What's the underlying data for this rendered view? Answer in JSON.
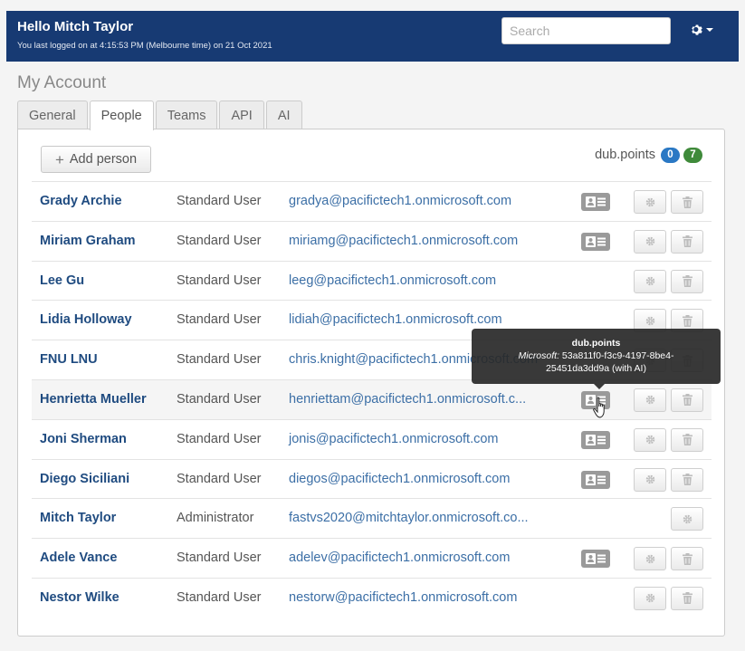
{
  "header": {
    "greeting": "Hello Mitch Taylor",
    "last_login": "You last logged on at 4:15:53 PM (Melbourne time) on 21 Oct 2021",
    "search_placeholder": "Search",
    "settings_icon": "gear-icon"
  },
  "page": {
    "title": "My Account"
  },
  "tabs": [
    {
      "label": "General",
      "active": false
    },
    {
      "label": "People",
      "active": true
    },
    {
      "label": "Teams",
      "active": false
    },
    {
      "label": "API",
      "active": false
    },
    {
      "label": "AI",
      "active": false
    }
  ],
  "toolbar": {
    "add_person_label": "Add person",
    "points_label": "dub.points",
    "points_blue": "0",
    "points_green": "7"
  },
  "people": [
    {
      "name": "Grady Archie",
      "role": "Standard User",
      "email": "gradya@pacifictech1.onmicrosoft.com",
      "card": true,
      "trash": true
    },
    {
      "name": "Miriam Graham",
      "role": "Standard User",
      "email": "miriamg@pacifictech1.onmicrosoft.com",
      "card": true,
      "trash": true
    },
    {
      "name": "Lee Gu",
      "role": "Standard User",
      "email": "leeg@pacifictech1.onmicrosoft.com",
      "card": false,
      "trash": true
    },
    {
      "name": "Lidia Holloway",
      "role": "Standard User",
      "email": "lidiah@pacifictech1.onmicrosoft.com",
      "card": false,
      "trash": true
    },
    {
      "name": "FNU LNU",
      "role": "Standard User",
      "email": "chris.knight@pacifictech1.onmicrosoft.com",
      "card": false,
      "trash": true
    },
    {
      "name": "Henrietta Mueller",
      "role": "Standard User",
      "email": "henriettam@pacifictech1.onmicrosoft.c...",
      "card": true,
      "trash": true
    },
    {
      "name": "Joni Sherman",
      "role": "Standard User",
      "email": "jonis@pacifictech1.onmicrosoft.com",
      "card": true,
      "trash": true
    },
    {
      "name": "Diego Siciliani",
      "role": "Standard User",
      "email": "diegos@pacifictech1.onmicrosoft.com",
      "card": true,
      "trash": true
    },
    {
      "name": "Mitch Taylor",
      "role": "Administrator",
      "email": "fastvs2020@mitchtaylor.onmicrosoft.co...",
      "card": false,
      "trash": false
    },
    {
      "name": "Adele Vance",
      "role": "Standard User",
      "email": "adelev@pacifictech1.onmicrosoft.com",
      "card": true,
      "trash": true
    },
    {
      "name": "Nestor Wilke",
      "role": "Standard User",
      "email": "nestorw@pacifictech1.onmicrosoft.com",
      "card": false,
      "trash": true
    }
  ],
  "hovered_row": 5,
  "tooltip": {
    "title": "dub.points",
    "provider": "Microsoft:",
    "line1": "53a811f0-f3c9-4197-8be4-",
    "line2": "25451da3dd9a (with AI)"
  },
  "colors": {
    "header_bg": "#173a73",
    "name_link": "#1f4b80",
    "email_link": "#3c6fa6",
    "badge_blue": "#2a78c4",
    "badge_green": "#3f8a3a"
  }
}
